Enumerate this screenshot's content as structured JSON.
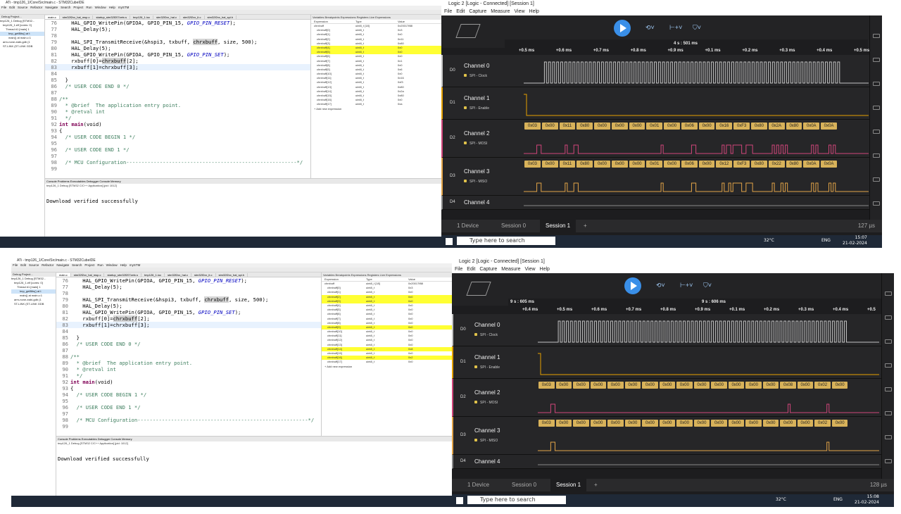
{
  "top": {
    "ide": {
      "title": "ATi - tmp126_1/Core/Src/main.c - STM32CubeIDE",
      "menu": [
        "File",
        "Edit",
        "Source",
        "Refactor",
        "Navigate",
        "Search",
        "Project",
        "Run",
        "Window",
        "Help",
        "mySTM"
      ],
      "editor_tabs": [
        "main.c",
        "stm32f2xx_hal_msp.c",
        "startup_stm32f207zetx.s",
        "tmp126_1.ioc",
        "stm32f2xx_hal.c",
        "stm32f2xx_it.c",
        "stm32f2xx_hal_spi.h"
      ],
      "project_tabs": "Debug  Project...",
      "project_tree": [
        "tmp126_1 Debug [STM32...",
        "tmp126_1.elf [cores: 0]",
        "Thread #1 [main] 1",
        "tmp_getBits() at t",
        "main() at main.c:1",
        "arm-none-eabi-gdb (1",
        "ST-LINK (ST-LINK GDB"
      ],
      "code": [
        {
          "n": "76",
          "segs": [
            {
              "t": "    HAL_GPIO_WritePin(GPIOA, GPIO_PIN_15, "
            },
            {
              "t": "GPIO_PIN_RESET",
              "c": "it"
            },
            {
              "t": ");"
            }
          ]
        },
        {
          "n": "77",
          "segs": [
            {
              "t": "    HAL_Delay(5);"
            }
          ]
        },
        {
          "n": "78",
          "segs": [
            {
              "t": ""
            }
          ]
        },
        {
          "n": "79",
          "segs": [
            {
              "t": "    HAL_SPI_TransmitReceive(&hspi3, txbuff, "
            },
            {
              "t": "chrxbuff",
              "c": "mark"
            },
            {
              "t": ", size, 500);"
            }
          ]
        },
        {
          "n": "80",
          "segs": [
            {
              "t": "    HAL_Delay(5);"
            }
          ]
        },
        {
          "n": "81",
          "segs": [
            {
              "t": "    HAL_GPIO_WritePin(GPIOA, GPIO_PIN_15, "
            },
            {
              "t": "GPIO_PIN_SET",
              "c": "it"
            },
            {
              "t": ");"
            }
          ]
        },
        {
          "n": "82",
          "segs": [
            {
              "t": "    rxbuff[0]="
            },
            {
              "t": "chrxbuff",
              "c": "mark"
            },
            {
              "t": "[2];"
            }
          ]
        },
        {
          "n": "83",
          "segs": [
            {
              "t": "    rxbuff[1]=chrxbuff[3];"
            }
          ],
          "hl": true
        },
        {
          "n": "84",
          "segs": [
            {
              "t": ""
            }
          ]
        },
        {
          "n": "85",
          "segs": [
            {
              "t": "  }"
            }
          ]
        },
        {
          "n": "86",
          "segs": [
            {
              "t": "  "
            },
            {
              "t": "/* USER CODE END 0 */",
              "c": "cm"
            }
          ]
        },
        {
          "n": "87",
          "segs": [
            {
              "t": ""
            }
          ]
        },
        {
          "n": "88",
          "segs": [
            {
              "t": "/**",
              "c": "cm"
            }
          ]
        },
        {
          "n": "89",
          "segs": [
            {
              "t": "  * @brief  The application entry point.",
              "c": "cm"
            }
          ]
        },
        {
          "n": "90",
          "segs": [
            {
              "t": "  * @retval int",
              "c": "cm"
            }
          ]
        },
        {
          "n": "91",
          "segs": [
            {
              "t": "  */",
              "c": "cm"
            }
          ]
        },
        {
          "n": "92",
          "segs": [
            {
              "t": "int",
              "c": "kw"
            },
            {
              "t": " "
            },
            {
              "t": "main",
              "c": "kw"
            },
            {
              "t": "(void)"
            }
          ]
        },
        {
          "n": "93",
          "segs": [
            {
              "t": "{"
            }
          ]
        },
        {
          "n": "94",
          "segs": [
            {
              "t": "  "
            },
            {
              "t": "/* USER CODE BEGIN 1 */",
              "c": "cm"
            }
          ]
        },
        {
          "n": "95",
          "segs": [
            {
              "t": ""
            }
          ]
        },
        {
          "n": "96",
          "segs": [
            {
              "t": "  "
            },
            {
              "t": "/* USER CODE END 1 */",
              "c": "cm"
            }
          ]
        },
        {
          "n": "97",
          "segs": [
            {
              "t": ""
            }
          ]
        },
        {
          "n": "98",
          "segs": [
            {
              "t": "  "
            },
            {
              "t": "/* MCU Configuration--------------------------------------------------------*/",
              "c": "cm"
            }
          ]
        },
        {
          "n": "99",
          "segs": [
            {
              "t": ""
            }
          ]
        }
      ],
      "console_tabs": "Console  Problems  Executables  Debugger Console  Memory",
      "console_sub": "tmp126_1 Debug [STM32 C/C++ Application]  [pid: 1012]",
      "console_msg": "Download verified successfully",
      "expr_tabs": "Variables  Breakpoints  Expressions  Registers  Live Expressions",
      "expr_head": [
        "Expression",
        "Type",
        "Value"
      ],
      "expressions": [
        {
          "e": "chrxbuff",
          "t": "uint8_t [18]",
          "v": "0x20017f88"
        },
        {
          "e": "chrxbuff[0]",
          "t": "uint8_t",
          "v": "0x3"
        },
        {
          "e": "chrxbuff[1]",
          "t": "uint8_t",
          "v": "0x0"
        },
        {
          "e": "chrxbuff[2]",
          "t": "uint8_t",
          "v": "0x11"
        },
        {
          "e": "chrxbuff[3]",
          "t": "uint8_t",
          "v": "0x80"
        },
        {
          "e": "chrxbuff[4]",
          "t": "uint8_t",
          "v": "0x0",
          "y": true
        },
        {
          "e": "chrxbuff[5]",
          "t": "uint8_t",
          "v": "0x0",
          "y": true
        },
        {
          "e": "chrxbuff[6]",
          "t": "uint8_t",
          "v": "0x0"
        },
        {
          "e": "chrxbuff[7]",
          "t": "uint8_t",
          "v": "0x1"
        },
        {
          "e": "chrxbuff[8]",
          "t": "uint8_t",
          "v": "0x0"
        },
        {
          "e": "chrxbuff[9]",
          "t": "uint8_t",
          "v": "0x6"
        },
        {
          "e": "chrxbuff[10]",
          "t": "uint8_t",
          "v": "0x0"
        },
        {
          "e": "chrxbuff[11]",
          "t": "uint8_t",
          "v": "0x16"
        },
        {
          "e": "chrxbuff[12]",
          "t": "uint8_t",
          "v": "0xf3"
        },
        {
          "e": "chrxbuff[13]",
          "t": "uint8_t",
          "v": "0x80"
        },
        {
          "e": "chrxbuff[14]",
          "t": "uint8_t",
          "v": "0x2a"
        },
        {
          "e": "chrxbuff[15]",
          "t": "uint8_t",
          "v": "0x80"
        },
        {
          "e": "chrxbuff[16]",
          "t": "uint8_t",
          "v": "0x0"
        },
        {
          "e": "chrxbuff[17]",
          "t": "uint8_t",
          "v": "0xa"
        }
      ],
      "add_expr": "+ Add new expression"
    },
    "logic": {
      "title": "Logic 2 [Logic - Connected] [Session 1]",
      "menu": [
        "File",
        "Edit",
        "Capture",
        "Measure",
        "View",
        "Help"
      ],
      "time_cursor": "4 s : 501 ms",
      "ticks": [
        "+0.5 ms",
        "+0.6 ms",
        "+0.7 ms",
        "+0.8 ms",
        "+0.9 ms",
        "+0.1 ms",
        "+0.2 ms",
        "+0.3 ms",
        "+0.4 ms",
        "+0.5 ms"
      ],
      "channels": [
        {
          "d": "D0",
          "name": "Channel 0",
          "analyzer": "SPI - Clock"
        },
        {
          "d": "D1",
          "name": "Channel 1",
          "analyzer": "SPI - Enable"
        },
        {
          "d": "D2",
          "name": "Channel 2",
          "analyzer": "SPI - MOSI"
        },
        {
          "d": "D3",
          "name": "Channel 3",
          "analyzer": "SPI - MISO"
        },
        {
          "d": "D4",
          "name": "Channel 4",
          "analyzer": ""
        }
      ],
      "mosi": [
        "0x03",
        "0x00",
        "0x11",
        "0x80",
        "0x00",
        "0x00",
        "0x00",
        "0x01",
        "0x00",
        "0x06",
        "0x00",
        "0x16",
        "0xF3",
        "0x80",
        "0x2A",
        "0x80",
        "0x0A",
        "0x0A"
      ],
      "miso": [
        "0x03",
        "0x00",
        "0x11",
        "0x80",
        "0x00",
        "0x00",
        "0x00",
        "0x01",
        "0x00",
        "0x06",
        "0x00",
        "0x12",
        "0xF3",
        "0x80",
        "0x22",
        "0x80",
        "0x0A",
        "0x0A"
      ],
      "device": "1 Device",
      "sessions": [
        "Session 0",
        "Session 1"
      ],
      "add_session": "+",
      "zoom": "127 µs"
    },
    "taskbar": {
      "search": "Type here to search",
      "temp": "32°C",
      "lang": "ENG",
      "time": "15:07",
      "date": "21-02-2024"
    }
  },
  "bottom": {
    "ide": {
      "title": "ATi - tmp126_1/Core/Src/main.c - STM32CubeIDE",
      "menu": [
        "File",
        "Edit",
        "Source",
        "Refactor",
        "Navigate",
        "Search",
        "Project",
        "Run",
        "Window",
        "Help",
        "mySTM"
      ],
      "editor_tabs": [
        "main.c",
        "stm32f2xx_hal_msp.c",
        "startup_stm32f207zetx.s",
        "tmp126_1.ioc",
        "stm32f2xx_hal.c",
        "stm32f2xx_it.c",
        "stm32f2xx_hal_spi.h"
      ],
      "project_tabs": "Debug  Project...",
      "project_tree": [
        "tmp126_1 Debug [STM32...",
        "tmp126_1.elf [cores: 0]",
        "Thread #1 [main] 1",
        "tmp_getBits() at t",
        "main() at main.c:1",
        "arm-none-eabi-gdb (1",
        "ST-LINK (ST-LINK GDB"
      ],
      "code": [
        {
          "n": "76",
          "segs": [
            {
              "t": "    HAL_GPIO_WritePin(GPIOA, GPIO_PIN_15, "
            },
            {
              "t": "GPIO_PIN_RESET",
              "c": "it"
            },
            {
              "t": ");"
            }
          ]
        },
        {
          "n": "77",
          "segs": [
            {
              "t": "    HAL_Delay(5);"
            }
          ]
        },
        {
          "n": "78",
          "segs": [
            {
              "t": ""
            }
          ]
        },
        {
          "n": "79",
          "segs": [
            {
              "t": "    HAL_SPI_TransmitReceive(&hspi3, txbuff, "
            },
            {
              "t": "chrxbuff",
              "c": "mark"
            },
            {
              "t": ", size, 500);"
            }
          ]
        },
        {
          "n": "80",
          "segs": [
            {
              "t": "    HAL_Delay(5);"
            }
          ]
        },
        {
          "n": "81",
          "segs": [
            {
              "t": "    HAL_GPIO_WritePin(GPIOA, GPIO_PIN_15, "
            },
            {
              "t": "GPIO_PIN_SET",
              "c": "it"
            },
            {
              "t": ");"
            }
          ]
        },
        {
          "n": "82",
          "segs": [
            {
              "t": "    rxbuff[0]="
            },
            {
              "t": "chrxbuff",
              "c": "mark"
            },
            {
              "t": "[2];"
            }
          ]
        },
        {
          "n": "83",
          "segs": [
            {
              "t": "    rxbuff[1]=chrxbuff[3];"
            }
          ],
          "hl": true
        },
        {
          "n": "84",
          "segs": [
            {
              "t": ""
            }
          ]
        },
        {
          "n": "85",
          "segs": [
            {
              "t": "  }"
            }
          ]
        },
        {
          "n": "86",
          "segs": [
            {
              "t": "  "
            },
            {
              "t": "/* USER CODE END 0 */",
              "c": "cm"
            }
          ]
        },
        {
          "n": "87",
          "segs": [
            {
              "t": ""
            }
          ]
        },
        {
          "n": "88",
          "segs": [
            {
              "t": "/**",
              "c": "cm"
            }
          ]
        },
        {
          "n": "89",
          "segs": [
            {
              "t": "  * @brief  The application entry point.",
              "c": "cm"
            }
          ]
        },
        {
          "n": "90",
          "segs": [
            {
              "t": "  * @retval int",
              "c": "cm"
            }
          ]
        },
        {
          "n": "91",
          "segs": [
            {
              "t": "  */",
              "c": "cm"
            }
          ]
        },
        {
          "n": "92",
          "segs": [
            {
              "t": "int",
              "c": "kw"
            },
            {
              "t": " "
            },
            {
              "t": "main",
              "c": "kw"
            },
            {
              "t": "(void)"
            }
          ]
        },
        {
          "n": "93",
          "segs": [
            {
              "t": "{"
            }
          ]
        },
        {
          "n": "94",
          "segs": [
            {
              "t": "  "
            },
            {
              "t": "/* USER CODE BEGIN 1 */",
              "c": "cm"
            }
          ]
        },
        {
          "n": "95",
          "segs": [
            {
              "t": ""
            }
          ]
        },
        {
          "n": "96",
          "segs": [
            {
              "t": "  "
            },
            {
              "t": "/* USER CODE END 1 */",
              "c": "cm"
            }
          ]
        },
        {
          "n": "97",
          "segs": [
            {
              "t": ""
            }
          ]
        },
        {
          "n": "98",
          "segs": [
            {
              "t": "  "
            },
            {
              "t": "/* MCU Configuration--------------------------------------------------------*/",
              "c": "cm"
            }
          ]
        },
        {
          "n": "99",
          "segs": [
            {
              "t": ""
            }
          ]
        }
      ],
      "console_tabs": "Console  Problems  Executables  Debugger Console  Memory",
      "console_sub": "tmp126_1 Debug [STM32 C/C++ Application]  [pid: 1012]",
      "console_msg": "Download verified successfully",
      "expr_tabs": "Variables  Breakpoints  Expressions  Registers  Live Expressions",
      "expr_head": [
        "Expression",
        "Type",
        "Value"
      ],
      "expressions": [
        {
          "e": "chrxbuff",
          "t": "uint8_t [18]",
          "v": "0x20017f88"
        },
        {
          "e": "chrxbuff[0]",
          "t": "uint8_t",
          "v": "0x3"
        },
        {
          "e": "chrxbuff[1]",
          "t": "uint8_t",
          "v": "0x0"
        },
        {
          "e": "chrxbuff[2]",
          "t": "uint8_t",
          "v": "0x0",
          "y": true
        },
        {
          "e": "chrxbuff[3]",
          "t": "uint8_t",
          "v": "0x0",
          "y": true
        },
        {
          "e": "chrxbuff[4]",
          "t": "uint8_t",
          "v": "0x0"
        },
        {
          "e": "chrxbuff[5]",
          "t": "uint8_t",
          "v": "0x0"
        },
        {
          "e": "chrxbuff[6]",
          "t": "uint8_t",
          "v": "0x0"
        },
        {
          "e": "chrxbuff[7]",
          "t": "uint8_t",
          "v": "0x0"
        },
        {
          "e": "chrxbuff[8]",
          "t": "uint8_t",
          "v": "0x0"
        },
        {
          "e": "chrxbuff[9]",
          "t": "uint8_t",
          "v": "0x0",
          "y": true
        },
        {
          "e": "chrxbuff[10]",
          "t": "uint8_t",
          "v": "0x0"
        },
        {
          "e": "chrxbuff[11]",
          "t": "uint8_t",
          "v": "0x0"
        },
        {
          "e": "chrxbuff[12]",
          "t": "uint8_t",
          "v": "0x0"
        },
        {
          "e": "chrxbuff[13]",
          "t": "uint8_t",
          "v": "0x0"
        },
        {
          "e": "chrxbuff[14]",
          "t": "uint8_t",
          "v": "0x8",
          "y": true
        },
        {
          "e": "chrxbuff[15]",
          "t": "uint8_t",
          "v": "0x0"
        },
        {
          "e": "chrxbuff[16]",
          "t": "uint8_t",
          "v": "0x2",
          "y": true
        },
        {
          "e": "chrxbuff[17]",
          "t": "uint8_t",
          "v": "0x0"
        }
      ],
      "add_expr": "+ Add new expression"
    },
    "logic": {
      "title": "Logic 2 [Logic - Connected] [Session 1]",
      "menu": [
        "File",
        "Edit",
        "Capture",
        "Measure",
        "View",
        "Help"
      ],
      "time_cursor_left": "9 s : 605 ms",
      "time_cursor": "9 s : 606 ms",
      "ticks": [
        "+0.4 ms",
        "+0.5 ms",
        "+0.6 ms",
        "+0.7 ms",
        "+0.8 ms",
        "+0.9 ms",
        "+0.1 ms",
        "+0.2 ms",
        "+0.3 ms",
        "+0.4 ms",
        "+0.5"
      ],
      "channels": [
        {
          "d": "D0",
          "name": "Channel 0",
          "analyzer": "SPI - Clock"
        },
        {
          "d": "D1",
          "name": "Channel 1",
          "analyzer": "SPI - Enable"
        },
        {
          "d": "D2",
          "name": "Channel 2",
          "analyzer": "SPI - MOSI"
        },
        {
          "d": "D3",
          "name": "Channel 3",
          "analyzer": "SPI - MISO"
        },
        {
          "d": "D4",
          "name": "Channel 4",
          "analyzer": ""
        }
      ],
      "mosi": [
        "0x03",
        "0x00",
        "0x00",
        "0x00",
        "0x00",
        "0x00",
        "0x00",
        "0x00",
        "0x00",
        "0x00",
        "0x00",
        "0x00",
        "0x00",
        "0x00",
        "0x08",
        "0x00",
        "0x02",
        "0x00"
      ],
      "miso": [
        "0x03",
        "0x00",
        "0x00",
        "0x00",
        "0x00",
        "0x00",
        "0x00",
        "0x00",
        "0x00",
        "0x00",
        "0x00",
        "0x00",
        "0x00",
        "0x00",
        "0x00",
        "0x00",
        "0x02",
        "0x00"
      ],
      "device": "1 Device",
      "sessions": [
        "Session 0",
        "Session 1"
      ],
      "add_session": "+",
      "zoom": "128 µs"
    },
    "taskbar": {
      "search": "Type here to search",
      "temp": "32°C",
      "lang": "ENG",
      "time": "15:08",
      "date": "21-02-2024"
    }
  },
  "colors": {
    "ch0": "#c4c4c4",
    "ch1": "#e5a000",
    "ch2": "#d0457a",
    "ch3": "#e3a447",
    "logic_bg": "#1d1d1f",
    "play": "#3a8fe8",
    "highlight": "#ffff33"
  }
}
